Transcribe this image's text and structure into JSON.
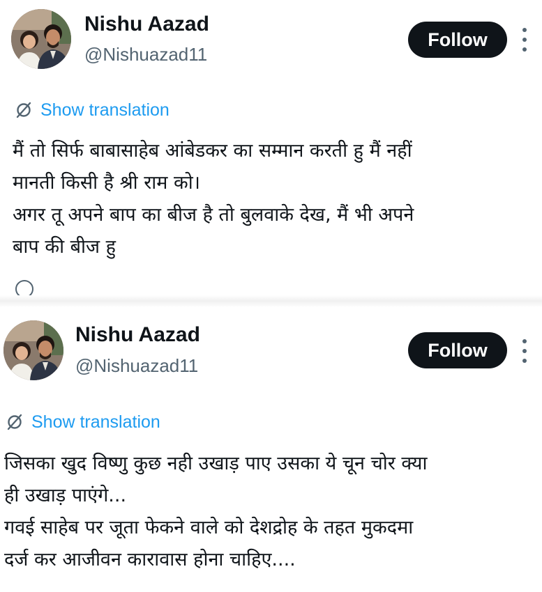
{
  "posts": [
    {
      "author": {
        "name": "Nishu Aazad",
        "handle": "@Nishuazad11"
      },
      "follow_label": "Follow",
      "translation_label": "Show translation",
      "text_lines": [
        "मैं तो सिर्फ बाबासाहेब आंबेडकर का सम्मान करती हु मैं नहीं",
        "मानती किसी है श्री राम को।",
        "अगर तू अपने बाप का बीज है तो बुलवाके देख, मैं भी अपने",
        "बाप की बीज हु"
      ]
    },
    {
      "author": {
        "name": "Nishu Aazad",
        "handle": "@Nishuazad11"
      },
      "follow_label": "Follow",
      "translation_label": "Show translation",
      "text_lines": [
        "जिसका खुद विष्णु कुछ नही उखाड़ पाए उसका ये चून चोर क्या",
        "ही उखाड़ पाएंगे...",
        "गवई साहेब पर जूता फेकने वाले को देशद्रोह के तहत मुकदमा",
        "दर्ज कर आजीवन कारावास होना चाहिए...."
      ]
    }
  ],
  "icons": {
    "more": "more-vertical-icon",
    "translate": "globe-slash-icon",
    "avatar": "profile-photo"
  },
  "colors": {
    "text": "#0f1419",
    "secondary_text": "#536471",
    "link": "#1d9bf0",
    "follow_button_bg": "#0f1419",
    "follow_button_text": "#ffffff",
    "background": "#ffffff"
  }
}
